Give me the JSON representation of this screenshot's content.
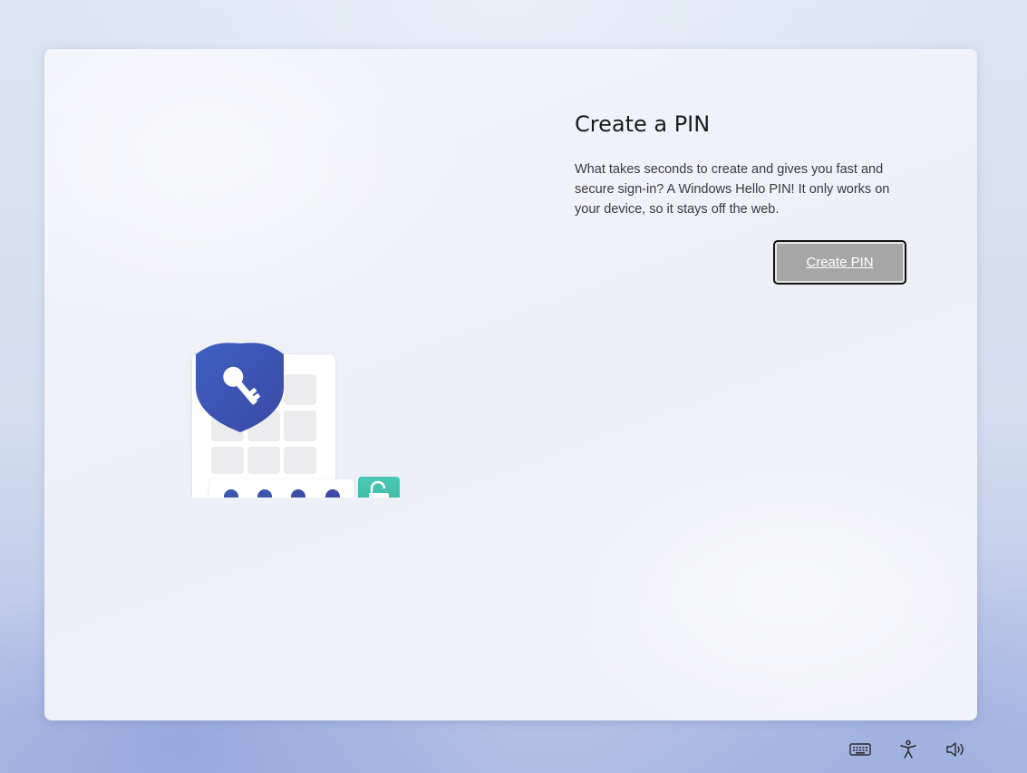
{
  "page": {
    "title": "Create a PIN",
    "description": "What takes seconds to create and gives you fast and secure sign-in? A Windows Hello PIN! It only works on your device, so it stays off the web.",
    "create_pin_button": "Create PIN"
  },
  "illustration": {
    "shield_icon": "shield-key-icon",
    "keypad_icon": "keypad-icon",
    "pin_dots": 4,
    "unlock_icon": "unlocked-padlock-icon"
  },
  "taskbar": {
    "icons": [
      "keyboard-icon",
      "accessibility-icon",
      "volume-icon"
    ]
  },
  "colors": {
    "shield": "#3b55b4",
    "pin_dot": "#3a4fae",
    "unlock": "#3dbfa9",
    "button_bg": "#a6a6a6"
  }
}
